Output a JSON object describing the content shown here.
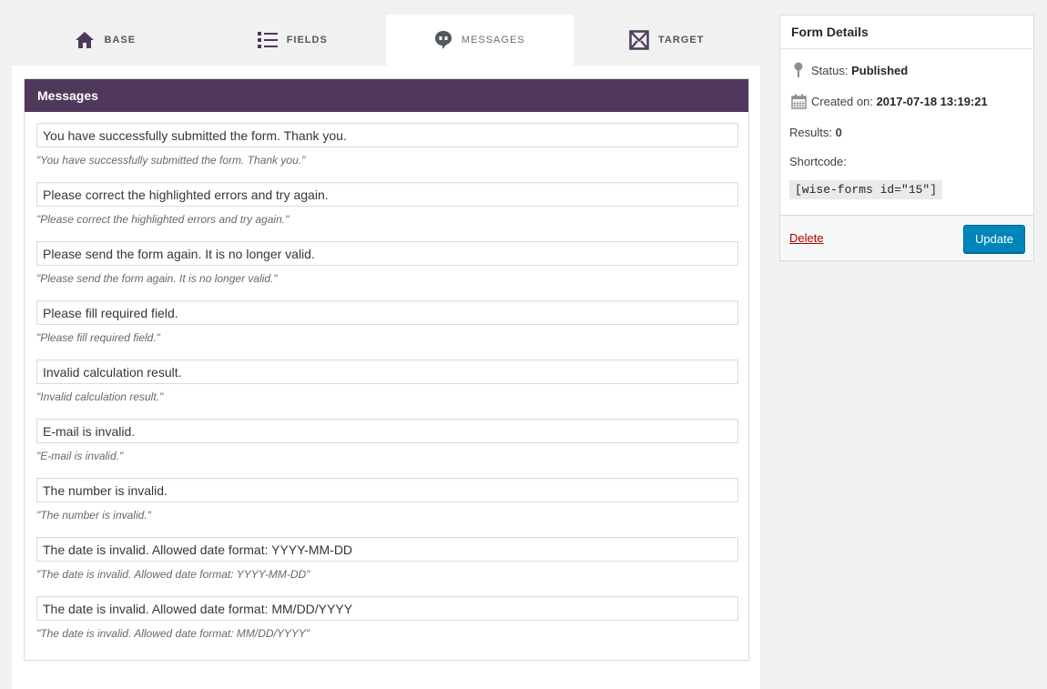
{
  "tabs": [
    {
      "label": "BASE",
      "icon": "home-icon"
    },
    {
      "label": "FIELDS",
      "icon": "list-icon"
    },
    {
      "label": "MESSAGES",
      "icon": "chat-bubble-icon"
    },
    {
      "label": "TARGET",
      "icon": "envelope-icon"
    }
  ],
  "active_tab": "MESSAGES",
  "messages": {
    "title": "Messages",
    "items": [
      {
        "value": "You have successfully submitted the form. Thank you.",
        "hint": "\"You have successfully submitted the form. Thank you.\""
      },
      {
        "value": "Please correct the highlighted errors and try again.",
        "hint": "\"Please correct the highlighted errors and try again.\""
      },
      {
        "value": "Please send the form again. It is no longer valid.",
        "hint": "\"Please send the form again. It is no longer valid.\""
      },
      {
        "value": "Please fill required field.",
        "hint": "\"Please fill required field.\""
      },
      {
        "value": "Invalid calculation result.",
        "hint": "\"Invalid calculation result.\""
      },
      {
        "value": "E-mail is invalid.",
        "hint": "\"E-mail is invalid.\""
      },
      {
        "value": "The number is invalid.",
        "hint": "\"The number is invalid.\""
      },
      {
        "value": "The date is invalid. Allowed date format: YYYY-MM-DD",
        "hint": "\"The date is invalid. Allowed date format: YYYY-MM-DD\""
      },
      {
        "value": "The date is invalid. Allowed date format: MM/DD/YYYY",
        "hint": "\"The date is invalid. Allowed date format: MM/DD/YYYY\""
      }
    ]
  },
  "form_details": {
    "title": "Form Details",
    "status_label": "Status:",
    "status_value": "Published",
    "created_label": "Created on:",
    "created_value": "2017-07-18 13:19:21",
    "results_label": "Results:",
    "results_value": "0",
    "shortcode_label": "Shortcode:",
    "shortcode_value": "[wise-forms id=\"15\"]",
    "delete_label": "Delete",
    "update_label": "Update"
  },
  "colors": {
    "accent_purple": "#4f385c",
    "button_blue": "#0085ba",
    "delete_red": "#aa0000"
  }
}
